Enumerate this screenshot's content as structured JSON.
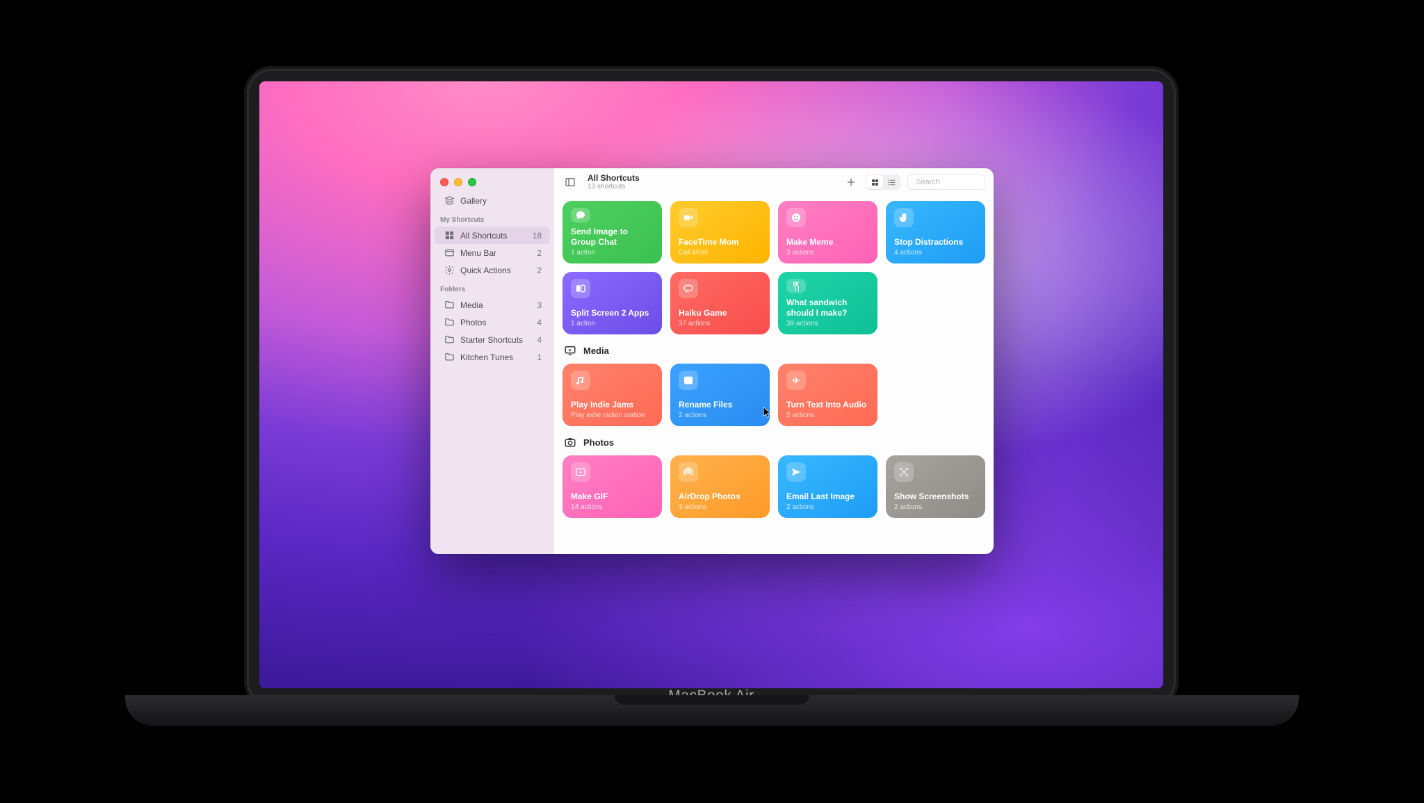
{
  "device_label": "MacBook Air",
  "sidebar": {
    "gallery": "Gallery",
    "heads": {
      "my": "My Shortcuts",
      "folders": "Folders"
    },
    "my": [
      {
        "icon": "grid",
        "label": "All Shortcuts",
        "count": 18,
        "selected": true
      },
      {
        "icon": "menubar",
        "label": "Menu Bar",
        "count": 2,
        "selected": false
      },
      {
        "icon": "gear",
        "label": "Quick Actions",
        "count": 2,
        "selected": false
      }
    ],
    "folders": [
      {
        "label": "Media",
        "count": 3
      },
      {
        "label": "Photos",
        "count": 4
      },
      {
        "label": "Starter Shortcuts",
        "count": 4
      },
      {
        "label": "Kitchen Tunes",
        "count": 1
      }
    ]
  },
  "toolbar": {
    "title": "All Shortcuts",
    "subtitle": "13 shortcuts",
    "search_placeholder": "Search"
  },
  "sections": [
    {
      "id": "top",
      "show_head": false,
      "icon": "",
      "label": "",
      "cards": [
        {
          "title": "Send Image to Group Chat",
          "sub": "1 action",
          "grad": "g-green",
          "icon": "chat"
        },
        {
          "title": "FaceTime Mom",
          "sub": "Call Mom",
          "grad": "g-yellow",
          "icon": "facetime"
        },
        {
          "title": "Make Meme",
          "sub": "3 actions",
          "grad": "g-pink",
          "icon": "smile"
        },
        {
          "title": "Stop Distractions",
          "sub": "4 actions",
          "grad": "g-blue",
          "icon": "hand"
        },
        {
          "title": "Split Screen 2 Apps",
          "sub": "1 action",
          "grad": "g-purple",
          "icon": "split"
        },
        {
          "title": "Haiku Game",
          "sub": "37 actions",
          "grad": "g-red",
          "icon": "bubble"
        },
        {
          "title": "What sandwich should I make?",
          "sub": "39 actions",
          "grad": "g-teal",
          "icon": "fork"
        }
      ]
    },
    {
      "id": "media",
      "show_head": true,
      "icon": "tv",
      "label": "Media",
      "cards": [
        {
          "title": "Play Indie Jams",
          "sub": "Play indie radion station",
          "grad": "g-coral",
          "icon": "music"
        },
        {
          "title": "Rename Files",
          "sub": "2 actions",
          "grad": "g-azure",
          "icon": "finder"
        },
        {
          "title": "Turn Text Into Audio",
          "sub": "5 actions",
          "grad": "g-coral",
          "icon": "wave"
        }
      ]
    },
    {
      "id": "photos",
      "show_head": true,
      "icon": "camera",
      "label": "Photos",
      "cards": [
        {
          "title": "Make GIF",
          "sub": "14 actions",
          "grad": "g-pink",
          "icon": "gif"
        },
        {
          "title": "AirDrop Photos",
          "sub": "3 actions",
          "grad": "g-orange",
          "icon": "airdrop"
        },
        {
          "title": "Email Last Image",
          "sub": "2 actions",
          "grad": "g-blue",
          "icon": "send"
        },
        {
          "title": "Show Screenshots",
          "sub": "2 actions",
          "grad": "g-gray",
          "icon": "screenshot"
        }
      ]
    }
  ]
}
